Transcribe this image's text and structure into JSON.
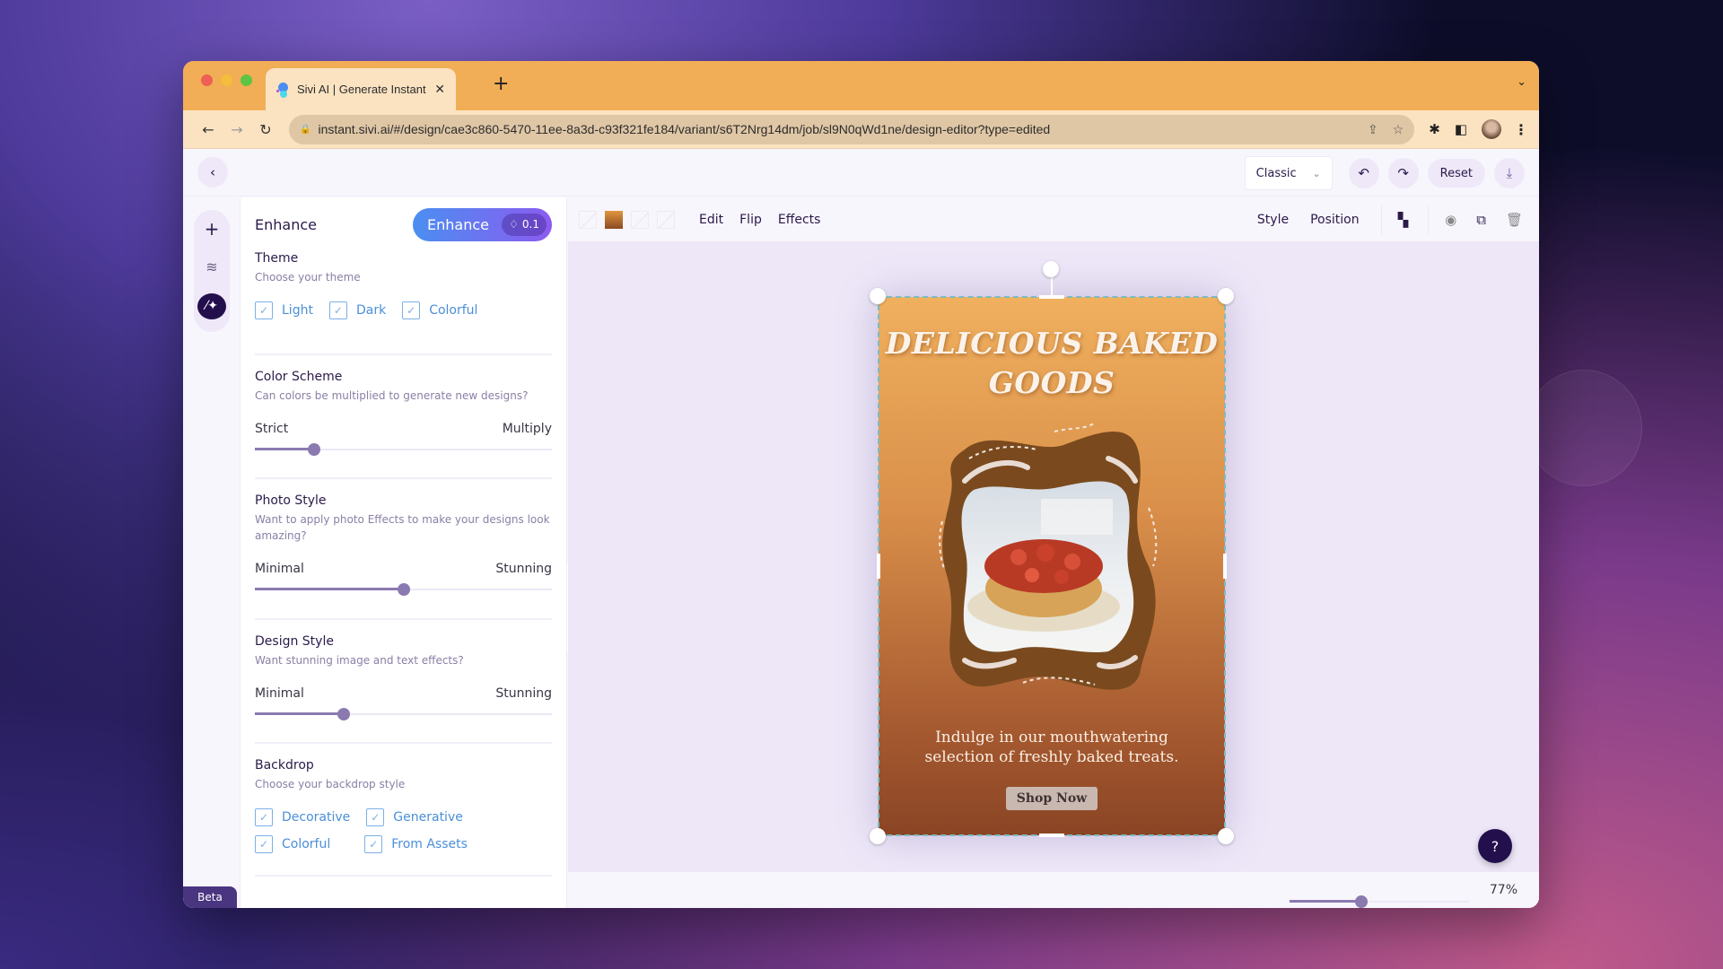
{
  "browser": {
    "tab_title": "Sivi AI | Generate Instant Desig",
    "new_tab_icon": "+",
    "url": "instant.sivi.ai/#/design/cae3c860-5470-11ee-8a3d-c93f321fe184/variant/s6T2Nrg14dm/job/sl9N0qWd1ne/design-editor?type=edited"
  },
  "header": {
    "mode_select": "Classic",
    "reset_label": "Reset"
  },
  "rail": {
    "beta_label": "Beta"
  },
  "panel": {
    "title": "Enhance",
    "enhance_button": "Enhance",
    "credit": "0.1",
    "theme": {
      "title": "Theme",
      "subtitle": "Choose your theme",
      "options": [
        {
          "label": "Light",
          "checked": true
        },
        {
          "label": "Dark",
          "checked": true
        },
        {
          "label": "Colorful",
          "checked": true
        }
      ]
    },
    "color_scheme": {
      "title": "Color Scheme",
      "subtitle": "Can colors be multiplied to generate new designs?",
      "min_label": "Strict",
      "max_label": "Multiply",
      "value_percent": 20
    },
    "photo_style": {
      "title": "Photo Style",
      "subtitle": "Want to apply photo Effects to make your designs look amazing?",
      "min_label": "Minimal",
      "max_label": "Stunning",
      "value_percent": 50
    },
    "design_style": {
      "title": "Design Style",
      "subtitle": "Want stunning image and text effects?",
      "min_label": "Minimal",
      "max_label": "Stunning",
      "value_percent": 30
    },
    "backdrop": {
      "title": "Backdrop",
      "subtitle": "Choose your backdrop style",
      "options": [
        {
          "label": "Decorative",
          "checked": true
        },
        {
          "label": "Generative",
          "checked": true
        },
        {
          "label": "Colorful",
          "checked": true
        },
        {
          "label": "From Assets",
          "checked": true
        }
      ]
    }
  },
  "toolbar": {
    "edit": "Edit",
    "flip": "Flip",
    "effects": "Effects",
    "style": "Style",
    "position": "Position"
  },
  "design": {
    "headline": "DELICIOUS BAKED GOODS",
    "body": "Indulge in our mouthwatering selection of freshly baked treats.",
    "cta": "Shop Now",
    "colors": {
      "top": "#f0b05e",
      "bottom": "#8a4525",
      "frame": "#7a4a1e"
    }
  },
  "zoom": {
    "value_percent": 77,
    "label": "77%"
  }
}
